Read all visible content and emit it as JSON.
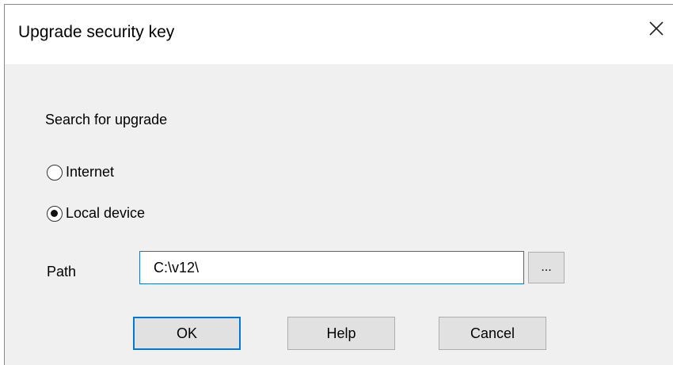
{
  "window": {
    "title": "Upgrade security key",
    "close_icon": "close-icon"
  },
  "search": {
    "label": "Search for upgrade",
    "options": [
      {
        "label": "Internet",
        "selected": false
      },
      {
        "label": "Local device",
        "selected": true
      }
    ]
  },
  "path": {
    "label": "Path",
    "value": "C:\\v12\\",
    "browse_label": "..."
  },
  "buttons": {
    "ok": "OK",
    "help": "Help",
    "cancel": "Cancel"
  },
  "colors": {
    "accent": "#0078d7",
    "dialog_bg": "#f0f0f0",
    "button_bg": "#e1e1e1"
  }
}
